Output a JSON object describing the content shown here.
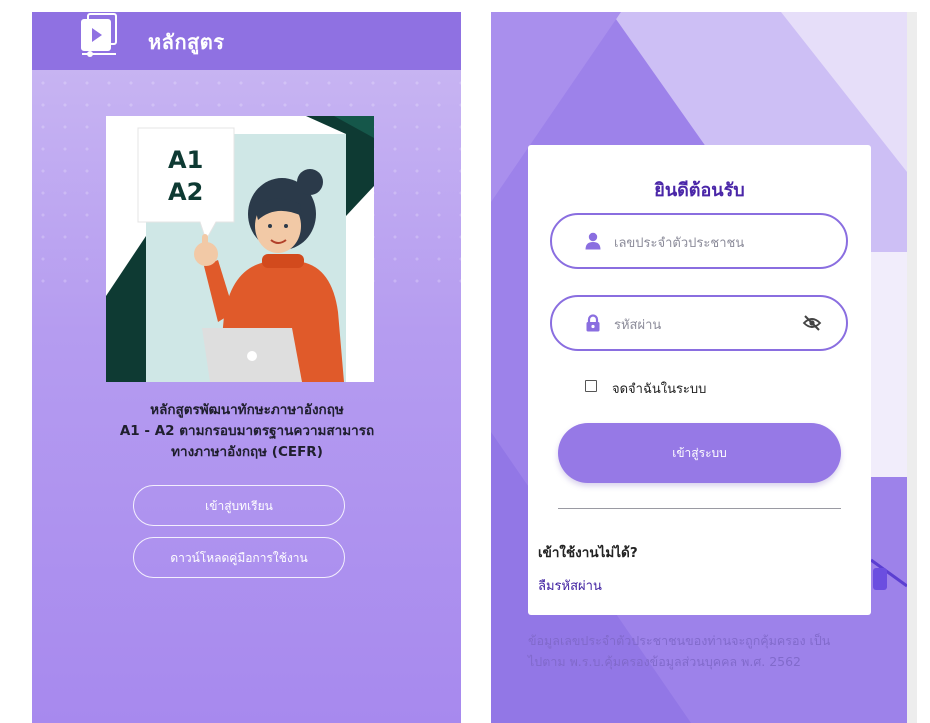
{
  "left": {
    "header_title": "หลักสูตร",
    "course_description_lines": [
      "หลักสูตรพัฒนาทักษะภาษาอังกฤษ",
      "A1 - A2 ตามกรอบมาตรฐานความสามารถ",
      "ทางภาษาอังกฤษ (CEFR)"
    ],
    "image_badge": {
      "line1": "A1",
      "line2": "A2"
    },
    "enter_lessons_label": "เข้าสู่บทเรียน",
    "download_manual_label": "ดาวน์โหลดคู่มือการใช้งาน"
  },
  "login": {
    "title": "ยินดีต้อนรับ",
    "id_placeholder": "เลขประจำตัวประชาชน",
    "password_placeholder": "รหัสผ่าน",
    "remember_label": "จดจำฉันในระบบ",
    "login_button": "เข้าสู่ระบบ",
    "cannot_login_title": "เข้าใช้งานไม่ได้?",
    "forgot_password": "ลืมรหัสผ่าน",
    "privacy_note_lines": [
      "ข้อมูลเลขประจำตัวประชาชนของท่านจะถูกคุ้มครอง เป็น",
      "ไปตาม พ.ร.บ.คุ้มครองข้อมูลส่วนบุคคล พ.ศ. 2562"
    ]
  },
  "icons": {
    "course": "course-video-icon",
    "user": "user-icon",
    "lock": "lock-icon",
    "eye_off": "eye-off-icon"
  },
  "colors": {
    "header_purple": "#8f71e2",
    "accent_purple": "#9679e6",
    "title_purple": "#4a26a8"
  }
}
